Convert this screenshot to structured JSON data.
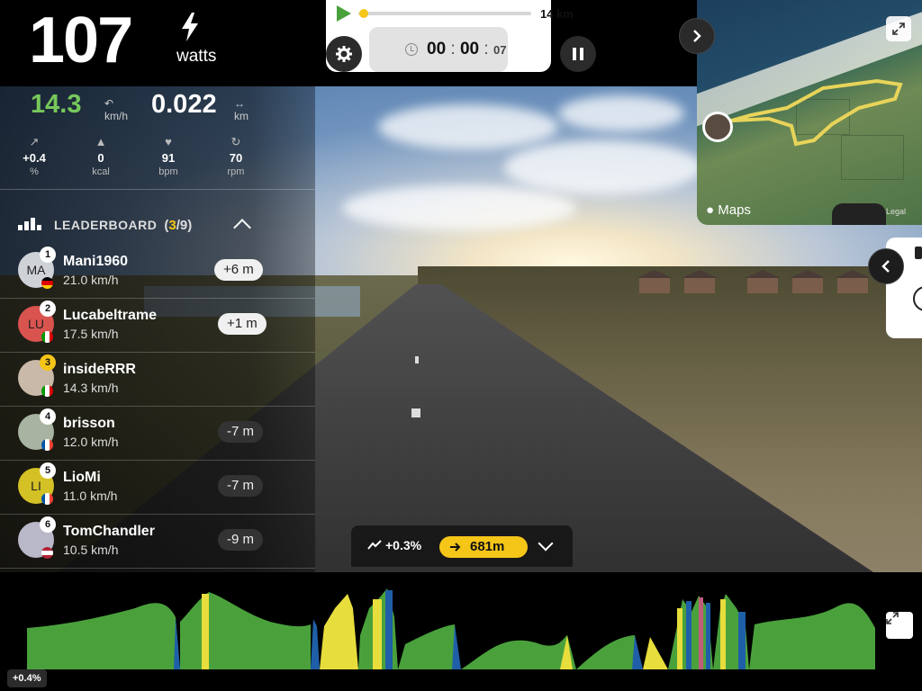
{
  "power": {
    "value": "107",
    "unit": "watts"
  },
  "progress": {
    "total_distance": "14 km",
    "fraction": 0.02
  },
  "timer": {
    "hours": "00",
    "minutes": "00",
    "seconds": "07",
    "sep": ":"
  },
  "metrics": {
    "speed": {
      "value": "14.3",
      "unit": "km/h"
    },
    "distance": {
      "value": "0.022",
      "unit": "km"
    },
    "mini": [
      {
        "value": "+0.4",
        "unit": "%",
        "icon": "slope-icon"
      },
      {
        "value": "0",
        "unit": "kcal",
        "icon": "flame-icon"
      },
      {
        "value": "91",
        "unit": "bpm",
        "icon": "heart-icon"
      },
      {
        "value": "70",
        "unit": "rpm",
        "icon": "cadence-icon"
      }
    ]
  },
  "leaderboard": {
    "title": "LEADERBOARD",
    "position": "3",
    "total": "/9",
    "open": "(",
    "close": ")",
    "riders": [
      {
        "rank": "1",
        "initials": "MA",
        "name": "Mani1960",
        "speed": "21.0 km/h",
        "gap": "+6 m",
        "ahead": true
      },
      {
        "rank": "2",
        "initials": "LU",
        "name": "Lucabeltrame",
        "speed": "17.5 km/h",
        "gap": "+1 m",
        "ahead": true
      },
      {
        "rank": "3",
        "initials": "",
        "name": "insideRRR",
        "speed": "14.3 km/h",
        "gap": "",
        "ahead": false
      },
      {
        "rank": "4",
        "initials": "",
        "name": "brisson",
        "speed": "12.0 km/h",
        "gap": "-7 m",
        "ahead": false
      },
      {
        "rank": "5",
        "initials": "LI",
        "name": "LioMi",
        "speed": "11.0 km/h",
        "gap": "-7 m",
        "ahead": false
      },
      {
        "rank": "6",
        "initials": "",
        "name": "TomChandler",
        "speed": "10.5 km/h",
        "gap": "-9 m",
        "ahead": false
      }
    ]
  },
  "segment": {
    "grade": "+0.3%",
    "distance": "681m"
  },
  "map": {
    "label": "Maps",
    "legal": "Legal"
  },
  "profile": {
    "current_grade": "+0.4%"
  },
  "colors": {
    "green": "#4aa13c",
    "yellow": "#e7dd3c",
    "blue": "#1f5fa8",
    "accent": "#f5c518"
  }
}
